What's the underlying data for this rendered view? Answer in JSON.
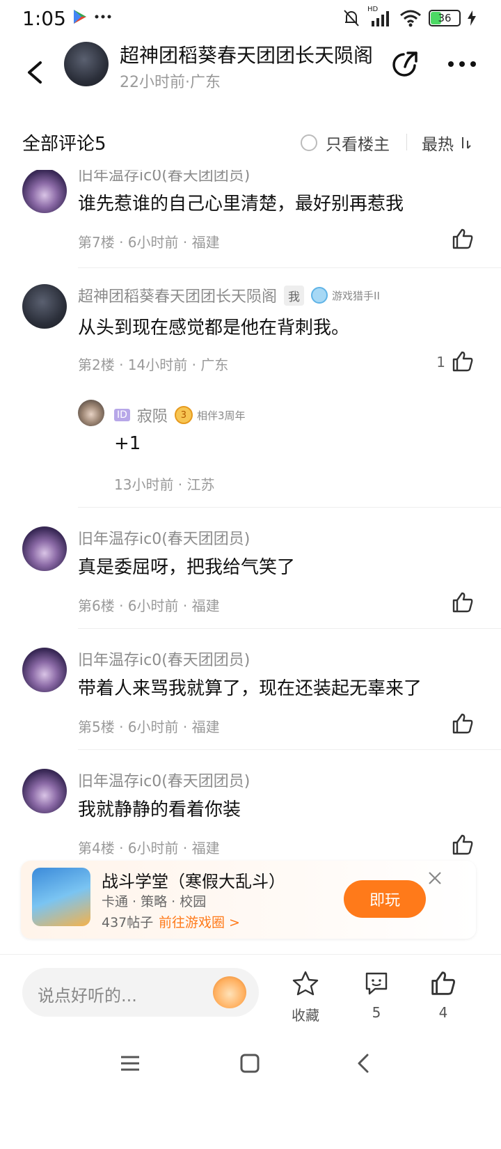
{
  "status_bar": {
    "time": "1:05",
    "network": "HD",
    "battery_level": "36"
  },
  "header": {
    "title": "超神团稻葵春天团团长天陨阁",
    "subtitle": "22小时前·广东"
  },
  "filter": {
    "all_comments": "全部评论5",
    "only_op": "只看楼主",
    "sort": "最热",
    "sort_icon": "sort-icon"
  },
  "comments": [
    {
      "name": "旧年温存ic0(春天团团员)",
      "text": "谁先惹谁的自己心里清楚，最好别再惹我",
      "meta": "第7楼 · 6小时前 · 福建",
      "likes": ""
    },
    {
      "name": "超神团稻葵春天团团长天陨阁",
      "tag": "我",
      "badge": "游戏猎手II",
      "text": "从头到现在感觉都是他在背刺我。",
      "meta": "第2楼 · 14小时前 · 广东",
      "likes": "1",
      "reply": {
        "id_tag": "ID",
        "name": "寂陨",
        "badge_num": "3",
        "badge": "相伴3周年",
        "text": "+1",
        "meta": "13小时前 · 江苏"
      }
    },
    {
      "name": "旧年温存ic0(春天团团员)",
      "text": "真是委屈呀，把我给气笑了",
      "meta": "第6楼 · 6小时前 · 福建",
      "likes": ""
    },
    {
      "name": "旧年温存ic0(春天团团员)",
      "text": "带着人来骂我就算了，现在还装起无辜来了",
      "meta": "第5楼 · 6小时前 · 福建",
      "likes": ""
    },
    {
      "name": "旧年温存ic0(春天团团员)",
      "text": "我就静静的看着你装",
      "meta": "第4楼 · 6小时前 · 福建",
      "likes": ""
    }
  ],
  "game_card": {
    "title": "战斗学堂（寒假大乱斗）",
    "tags": "卡通 · 策略 · 校园",
    "posts": "437帖子",
    "goto": "前往游戏圈 >",
    "play": "即玩"
  },
  "bottom_bar": {
    "input_placeholder": "说点好听的...",
    "collect_label": "收藏",
    "comment_count": "5",
    "like_count": "4"
  },
  "colors": {
    "accent": "#ff7a1a",
    "text_primary": "#111111",
    "text_secondary": "#9a9a9a"
  }
}
